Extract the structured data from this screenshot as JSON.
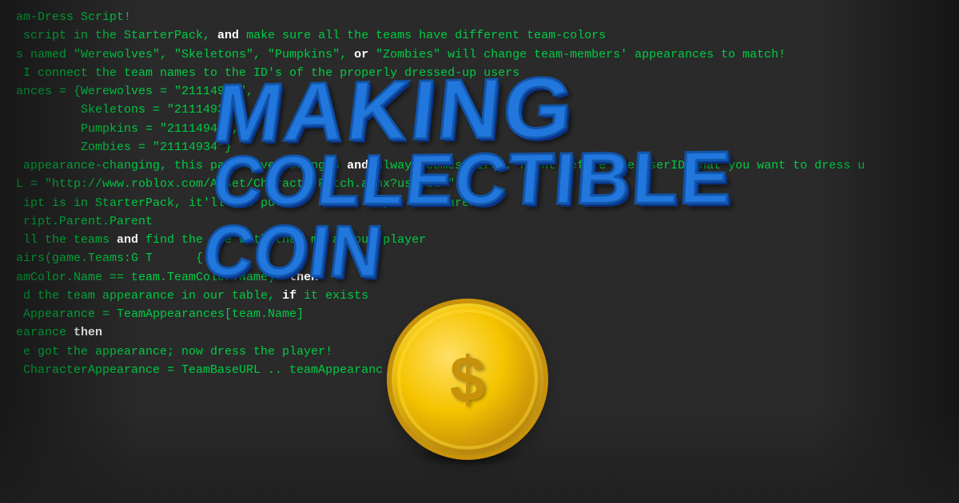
{
  "background": {
    "color": "#2a2a2a"
  },
  "code": {
    "lines": [
      "am-Dress Script!",
      " script in the StarterPack, and make sure all the teams have different team-colors",
      "s named \"Werewolves\", \"Skeletons\", \"Pumpkins\", or \"Zombies\" will change team-members' appearances to match!",
      "",
      " I connect the team names to the ID's of the properly dressed-up users",
      "ances = {Werewolves = \"21114944\",",
      "         Skeletons = \"21114931\",",
      "         Pumpkins = \"21114941\",",
      "         Zombies = \"21114934\"}",
      "",
      " appearance-changing, this part never changes and always comes first, right before the UserID that you want to dress u",
      "L = \"http://www.roblox.com/Asset/CharacterFetch.ashx?userId=\"",
      "",
      " ipt is in StarterPack, it'll get put i          ript. ent.Parent",
      " ript.Parent.Parent",
      "",
      " ll the teams and find the one with the  me as our player",
      "airs(game.Teams:G T      {",
      "amColor.Name == team.TeamColor.Name)  then",
      " d the team appearance in our table, if it exists",
      " Appearance = TeamAppearances[team.Name]",
      "earance then",
      " e got the appearance; now dress the player!",
      " CharacterAppearance = TeamBaseURL .. teamAppearanc"
    ]
  },
  "title": {
    "line1": "MAKING",
    "line2": "COLLECTIBLE COIN"
  },
  "coin": {
    "symbol": "$"
  }
}
